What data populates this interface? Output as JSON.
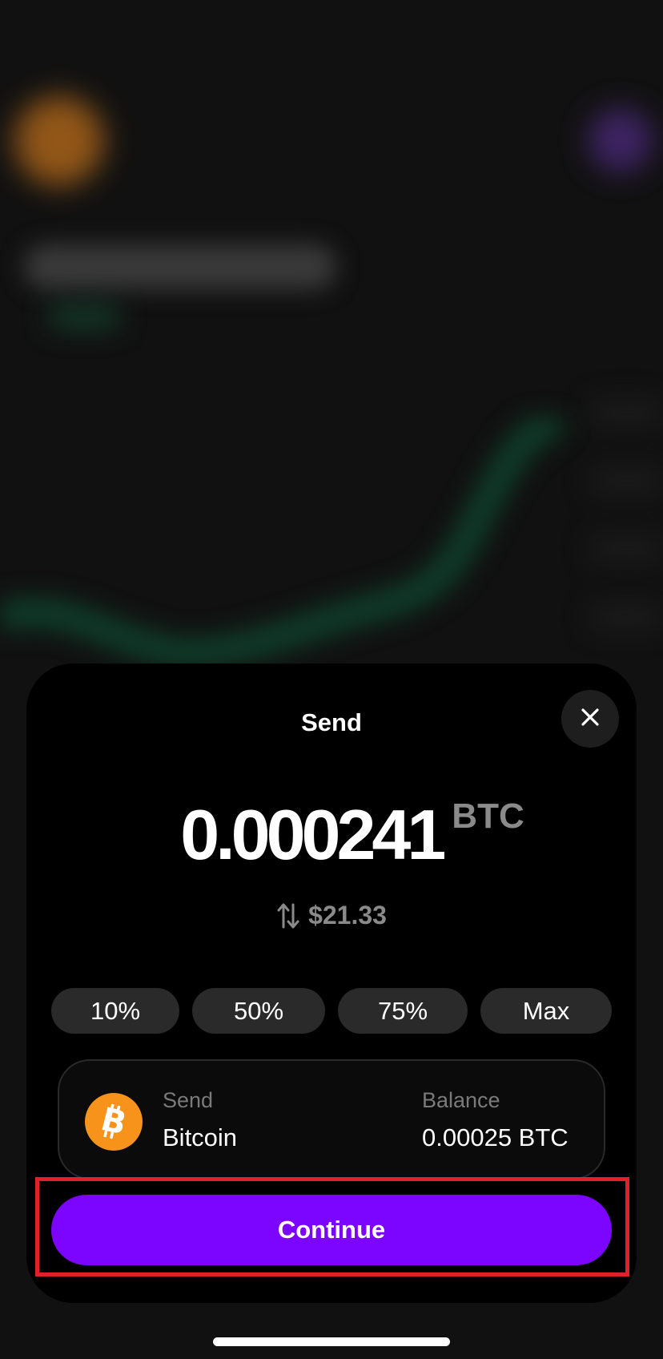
{
  "sheet": {
    "title": "Send",
    "close_icon": "close-icon"
  },
  "amount": {
    "value": "0.000241",
    "unit": "BTC",
    "fiat": "$21.33",
    "swap_icon": "swap-arrows-icon"
  },
  "quick_amounts": [
    "10%",
    "50%",
    "75%",
    "Max"
  ],
  "asset": {
    "icon": "bitcoin-icon",
    "send_label": "Send",
    "send_value": "Bitcoin",
    "balance_label": "Balance",
    "balance_value": "0.00025 BTC"
  },
  "continue_label": "Continue",
  "colors": {
    "accent": "#7b05ff",
    "bitcoin": "#f7931a",
    "highlight": "#e0202a"
  }
}
